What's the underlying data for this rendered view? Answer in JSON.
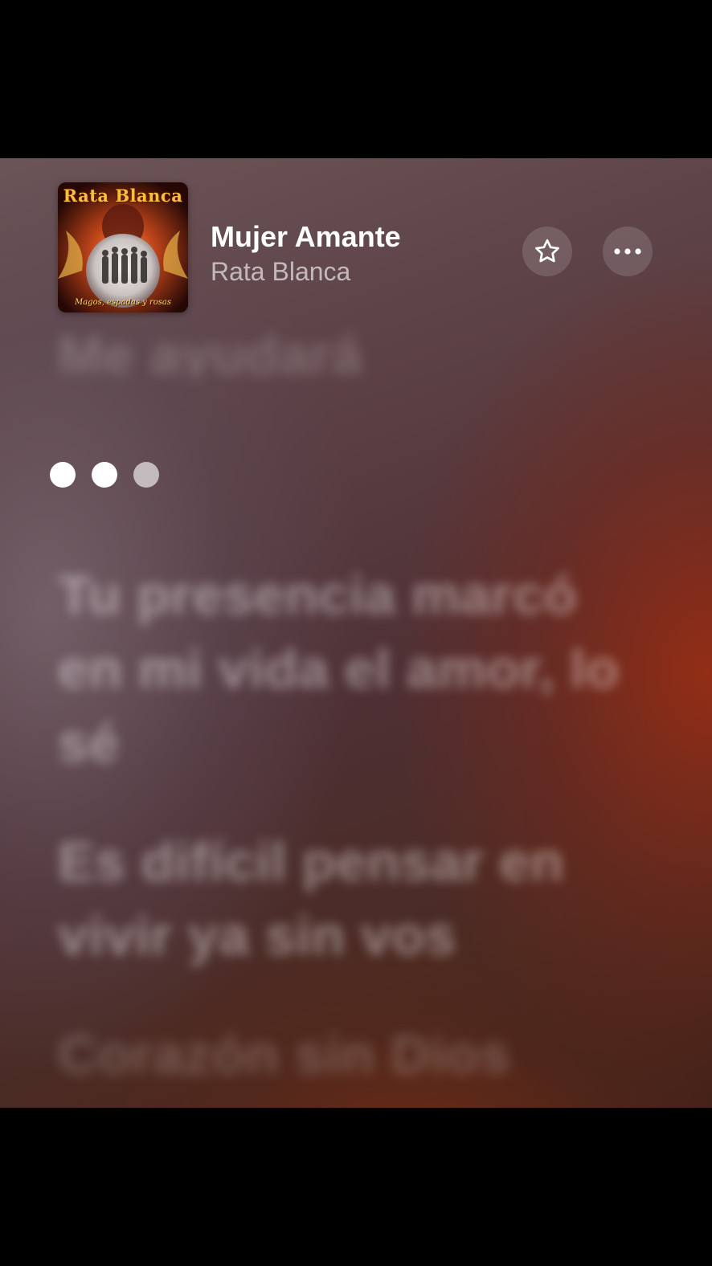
{
  "track": {
    "title": "Mujer Amante",
    "artist": "Rata Blanca"
  },
  "album_art": {
    "band_logo": "Rata Blanca",
    "cover_subtitle": "Magos, espadas y rosas"
  },
  "buttons": {
    "favorite_icon": "star-outline-icon",
    "more_icon": "ellipsis-icon"
  },
  "lyrics": {
    "previous": "Me ayudará",
    "line1": "Tu presencia marcó en mi vida el amor, lo sé",
    "line2": "Es difícil pensar en vivir ya sin vos",
    "line3": "Corazón sin Dios"
  },
  "instrumental_indicator": {
    "dot_count": 3,
    "active_dots": 2
  },
  "colors": {
    "accent_red": "#8a2c18",
    "text_primary": "#ffffff"
  }
}
